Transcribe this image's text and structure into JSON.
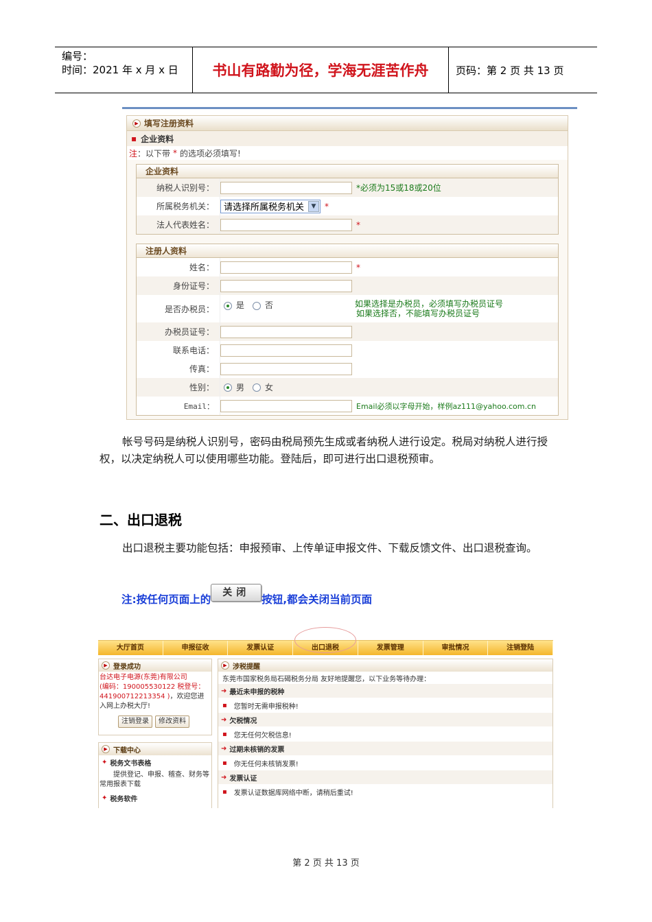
{
  "header": {
    "number_label": "编号：",
    "time": "时间：2021 年 x 月 x 日",
    "motto": "书山有路勤为径，学海无涯苦作舟",
    "page_info": "页码：第 2 页  共 13 页"
  },
  "form": {
    "title": "填写注册资料",
    "section": "企业资料",
    "note_prefix": "注",
    "note_text": "：以下带",
    "note_star": "*",
    "note_suffix": "的选项必须填写!",
    "company_box": {
      "title": "企业资料",
      "taxpayer_id_label": "纳税人识别号：",
      "taxpayer_id_hint": "*必须为15或18或20位",
      "tax_office_label": "所属税务机关：",
      "tax_office_selected": "请选择所属税务机关",
      "legal_rep_label": "法人代表姓名：",
      "star": "*"
    },
    "registrant_box": {
      "title": "注册人资料",
      "name_label": "姓名：",
      "id_label": "身份证号：",
      "is_agent_label": "是否办税员：",
      "yes": "是",
      "no": "否",
      "agent_hint_1": "如果选择是办税员，必须填写办税员证号",
      "agent_hint_2": "如果选择否，不能填写办税员证号",
      "agent_no_label": "办税员证号：",
      "phone_label": "联系电话：",
      "fax_label": "传真：",
      "gender_label": "性别：",
      "male": "男",
      "female": "女",
      "email_label": "Email：",
      "email_hint": "Email必须以字母开始，样例az111@yahoo.com.cn"
    }
  },
  "body": {
    "para1": "帐号号码是纳税人识别号，密码由税局预先生成或者纳税人进行设定。税局对纳税人进行授权，以决定纳税人可以使用哪些功能。登陆后，即可进行出口退税预审。",
    "heading": "二、出口退税",
    "para2": "出口退税主要功能包括：申报预审、上传单证申报文件、下载反馈文件、出口退税查询。",
    "note_before": "注:按任何页面上的",
    "close_button": "关闭",
    "note_after": "按钮,都会关闭当前页面"
  },
  "portal": {
    "nav": [
      "大厅首页",
      "申报征收",
      "发票认证",
      "出口退税",
      "发票管理",
      "审批情况",
      "注销登陆"
    ],
    "login": {
      "title": "登录成功",
      "company": "台达电子电源(东莞)有限公司",
      "codes": "(编码：190005530122 税登号：441900712213354 )",
      "welcome": "，欢迎您进入网上办税大厅!",
      "logout_button": "注销登录",
      "edit_button": "修改资料"
    },
    "download": {
      "title": "下载中心",
      "item1": "税务文书表格",
      "item1_desc": "提供登记、申报、稽查、财务等常用报表下载",
      "item2": "税务软件"
    },
    "reminder": {
      "title": "涉税提醒",
      "intro": "东莞市国家税务局石碣税务分局 友好地提醒您，以下业务等待办理：",
      "sections": [
        {
          "title": "最近未申报的税种",
          "item": "您暂时无需申报税种!"
        },
        {
          "title": "欠税情况",
          "item": "您无任何欠税信息!"
        },
        {
          "title": "过期未核销的发票",
          "item": "你无任何未核销发票!"
        },
        {
          "title": "发票认证",
          "item": "发票认证数据库网络中断，请稍后重试!"
        }
      ]
    }
  },
  "footer": "第 2 页 共 13 页"
}
